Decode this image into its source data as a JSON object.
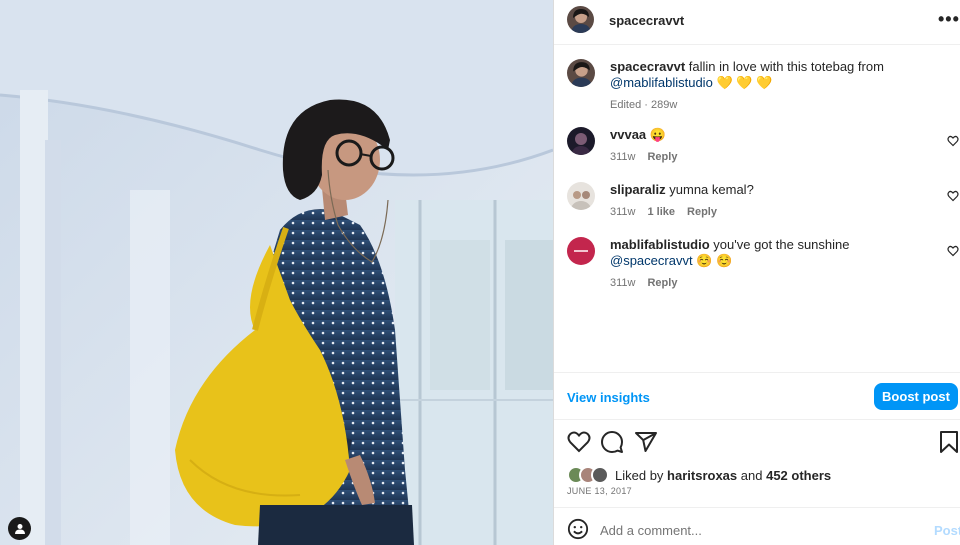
{
  "post": {
    "username": "spacecravvt",
    "caption": "fallin in love with this totebag from",
    "caption_mention": "@mablifablistudio",
    "caption_emoji": "💛 💛 💛",
    "edited_label": "Edited",
    "age": "289w"
  },
  "comments": [
    {
      "username": "vvvaa",
      "text": "😛",
      "mention": "",
      "emoji": "",
      "age": "311w",
      "likes": "",
      "reply": "Reply"
    },
    {
      "username": "sliparaliz",
      "text": "yumna kemal?",
      "mention": "",
      "emoji": "",
      "age": "311w",
      "likes": "1 like",
      "reply": "Reply"
    },
    {
      "username": "mablifablistudio",
      "text": "you've got the sunshine",
      "mention": "@spacecravvt",
      "emoji": "☺️ ☺️",
      "age": "311w",
      "likes": "",
      "reply": "Reply"
    }
  ],
  "insights_label": "View insights",
  "boost_label": "Boost post",
  "likes": {
    "prefix": "Liked by",
    "user": "haritsroxas",
    "connector": "and",
    "others": "452 others"
  },
  "date": "JUNE 13, 2017",
  "add_comment": {
    "placeholder": "Add a comment...",
    "post_label": "Post"
  },
  "colors": {
    "accent": "#0095f6",
    "link": "#00376b",
    "bag": "#e8c21a"
  },
  "icons": [
    "user-tag-icon",
    "more-icon",
    "heart-icon",
    "comment-icon",
    "share-icon",
    "bookmark-icon",
    "emoji-icon"
  ]
}
